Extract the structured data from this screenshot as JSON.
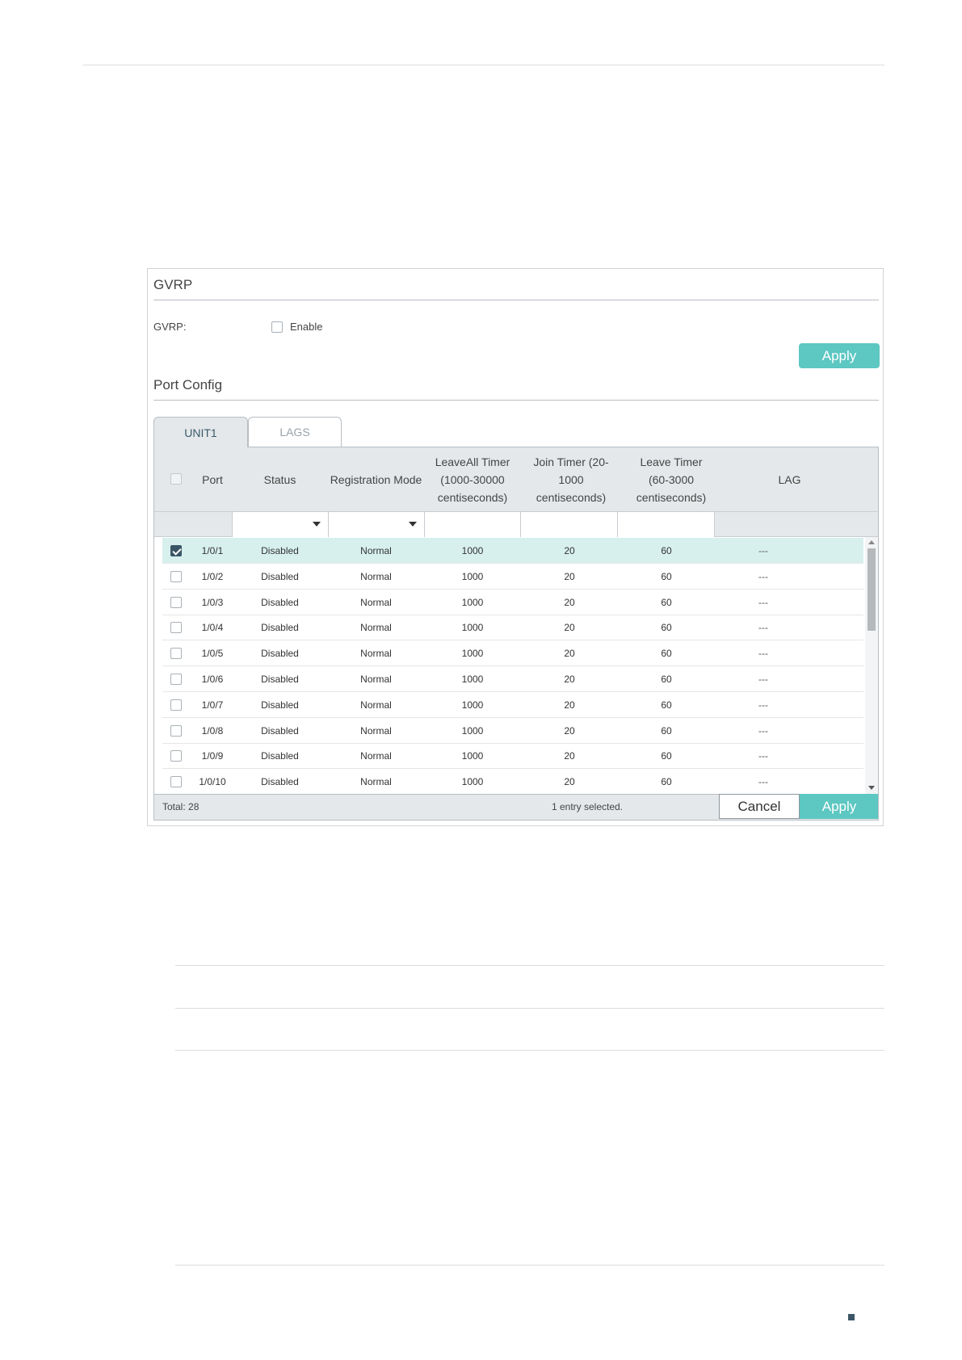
{
  "gvrp_section": {
    "title": "GVRP",
    "label": "GVRP:",
    "enable_checked": false,
    "enable_label": "Enable",
    "apply_label": "Apply"
  },
  "port_config": {
    "title": "Port Config",
    "tabs": [
      {
        "label": "UNIT1",
        "active": true
      },
      {
        "label": "LAGS",
        "active": false
      }
    ],
    "columns": {
      "port": "Port",
      "status": "Status",
      "registration_mode": "Registration Mode",
      "leaveall_timer": "LeaveAll Timer (1000-30000 centiseconds)",
      "join_timer": "Join Timer (20-1000 centiseconds)",
      "leave_timer": "Leave Timer (60-3000 centiseconds)",
      "lag": "LAG"
    },
    "rows": [
      {
        "port": "1/0/1",
        "status": "Disabled",
        "mode": "Normal",
        "leaveall": "1000",
        "join": "20",
        "leave": "60",
        "lag": "---",
        "checked": true
      },
      {
        "port": "1/0/2",
        "status": "Disabled",
        "mode": "Normal",
        "leaveall": "1000",
        "join": "20",
        "leave": "60",
        "lag": "---",
        "checked": false
      },
      {
        "port": "1/0/3",
        "status": "Disabled",
        "mode": "Normal",
        "leaveall": "1000",
        "join": "20",
        "leave": "60",
        "lag": "---",
        "checked": false
      },
      {
        "port": "1/0/4",
        "status": "Disabled",
        "mode": "Normal",
        "leaveall": "1000",
        "join": "20",
        "leave": "60",
        "lag": "---",
        "checked": false
      },
      {
        "port": "1/0/5",
        "status": "Disabled",
        "mode": "Normal",
        "leaveall": "1000",
        "join": "20",
        "leave": "60",
        "lag": "---",
        "checked": false
      },
      {
        "port": "1/0/6",
        "status": "Disabled",
        "mode": "Normal",
        "leaveall": "1000",
        "join": "20",
        "leave": "60",
        "lag": "---",
        "checked": false
      },
      {
        "port": "1/0/7",
        "status": "Disabled",
        "mode": "Normal",
        "leaveall": "1000",
        "join": "20",
        "leave": "60",
        "lag": "---",
        "checked": false
      },
      {
        "port": "1/0/8",
        "status": "Disabled",
        "mode": "Normal",
        "leaveall": "1000",
        "join": "20",
        "leave": "60",
        "lag": "---",
        "checked": false
      },
      {
        "port": "1/0/9",
        "status": "Disabled",
        "mode": "Normal",
        "leaveall": "1000",
        "join": "20",
        "leave": "60",
        "lag": "---",
        "checked": false
      },
      {
        "port": "1/0/10",
        "status": "Disabled",
        "mode": "Normal",
        "leaveall": "1000",
        "join": "20",
        "leave": "60",
        "lag": "---",
        "checked": false
      }
    ],
    "footer": {
      "total": "Total: 28",
      "selection": "1 entry selected.",
      "cancel_label": "Cancel",
      "apply_label": "Apply"
    }
  },
  "colors": {
    "accent": "#5dc7c2",
    "selected_row": "#d7f0ee",
    "header_bg": "#e4e8ea",
    "checked_box": "#3a5566"
  }
}
